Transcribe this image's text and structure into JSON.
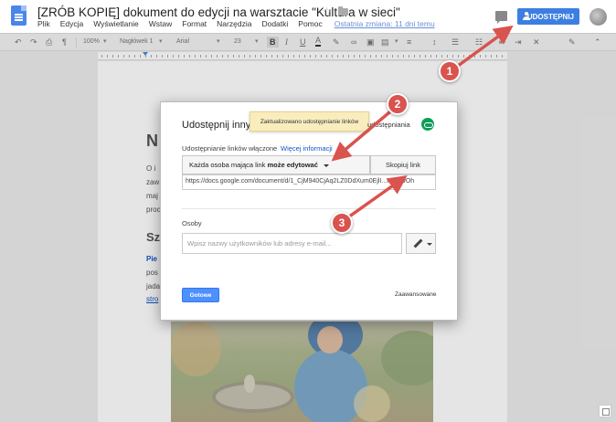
{
  "header": {
    "doc_title": "[ZRÓB KOPIĘ] dokument do edycji na warsztacie \"Kultura w sieci\"",
    "menu": [
      "Plik",
      "Edycja",
      "Wyświetlanie",
      "Wstaw",
      "Format",
      "Narzędzia",
      "Dodatki",
      "Pomoc"
    ],
    "last_edit": "Ostatnia zmiana: 11 dni temu",
    "share_button": "UDOSTĘPNIJ",
    "icons": [
      "docs-icon",
      "star-icon",
      "folder-icon",
      "comment-icon",
      "person-icon",
      "avatar"
    ]
  },
  "toolbar": {
    "zoom": "100%",
    "style": "Nagłówek 1",
    "font": "Arial",
    "font_size": "23",
    "bold": "B",
    "italic": "I",
    "underline": "U",
    "text_color": "A"
  },
  "document": {
    "heading_1": "N",
    "heading_2": "Sz",
    "para_1": [
      "O i",
      "zaw",
      "maj",
      "proc"
    ],
    "para_2": [
      "Pie",
      "pos",
      "jada",
      "stro"
    ]
  },
  "dialog": {
    "title": "Udostępnij innym",
    "toast": "Zaktualizowano udostępnianie linków",
    "sharing_settings": "udostępniania",
    "link_sharing_on": "Udostępnianie linków włączone",
    "more_info": "Więcej informacji",
    "permission_prefix": "Każda osoba mająca link ",
    "permission_bold": "może edytować",
    "copy_link": "Skopiuj link",
    "url": "https://docs.google.com/document/d/1_CjM940CjAq2LZ0DdXum0EjlI...KzOsvOh",
    "people_label": "Osoby",
    "people_placeholder": "Wpisz nazwy użytkowników lub adresy e-mail...",
    "done": "Gotowe",
    "advanced": "Zaawansowane"
  },
  "annotations": {
    "badges": [
      "1",
      "2",
      "3"
    ],
    "color": "#d9534f"
  },
  "colors": {
    "accent": "#4d90fe",
    "share": "#3d7fe0",
    "link_icon": "#0f9d58",
    "toast_bg": "#f9edbe"
  }
}
